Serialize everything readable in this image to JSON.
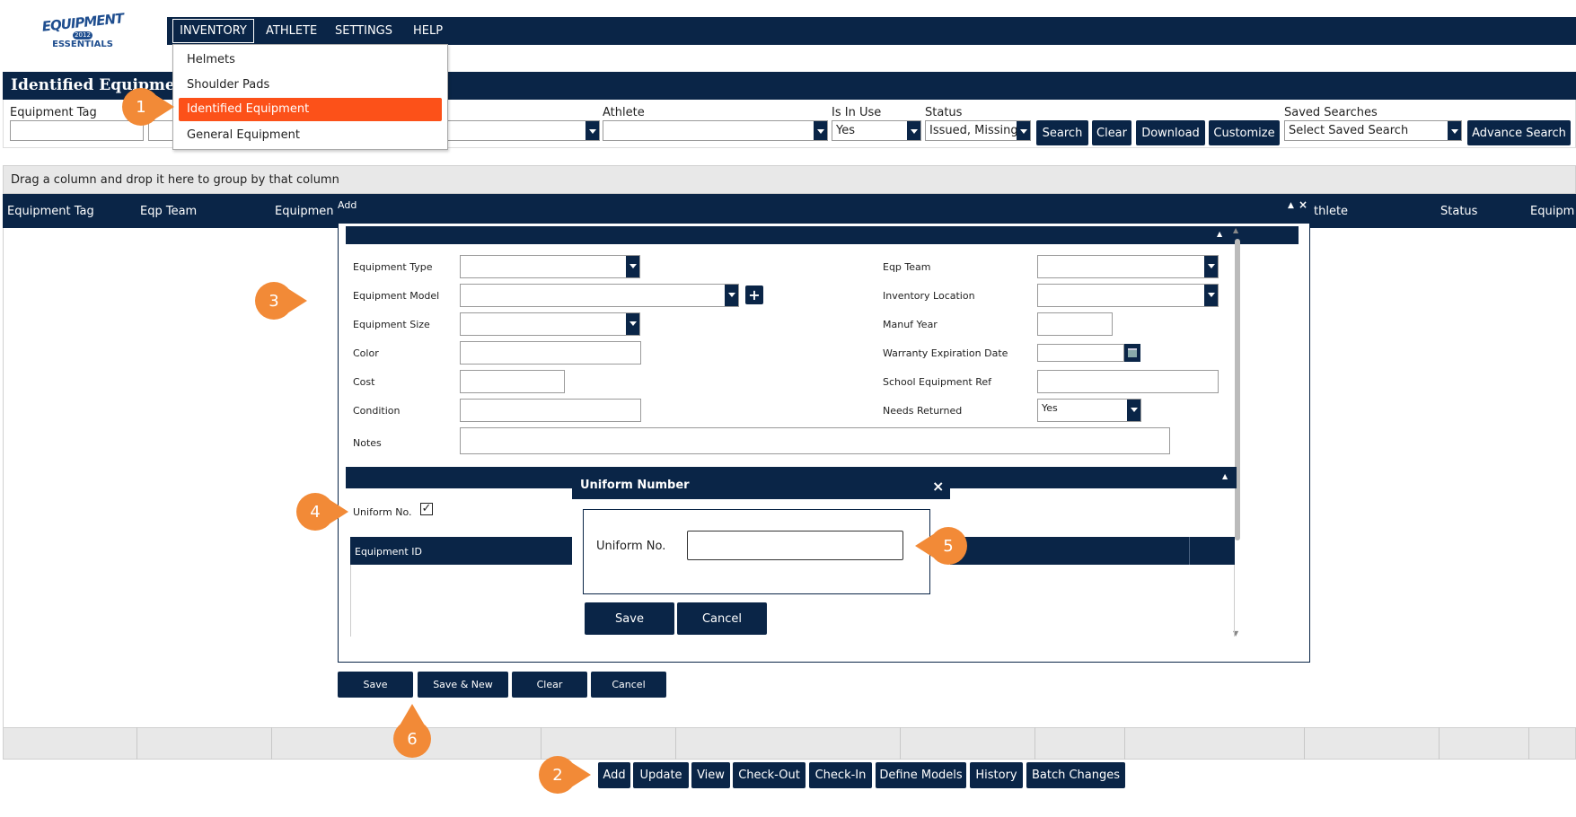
{
  "logo": {
    "line1": "EQUIPMENT",
    "year": "2012",
    "line2": "ESSENTIALS"
  },
  "nav": {
    "items": [
      "INVENTORY",
      "ATHLETE",
      "SETTINGS",
      "HELP"
    ]
  },
  "dropdown": {
    "items": [
      "Helmets",
      "Shoulder Pads",
      "Identified Equipment",
      "General Equipment"
    ]
  },
  "page": {
    "title": "Identified Equipment"
  },
  "filters": {
    "equipment_tag_label": "Equipment Tag",
    "athlete_label": "Athlete",
    "in_use_label": "Is In Use",
    "in_use_value": "Yes",
    "status_label": "Status",
    "status_value": "Issued, Missing",
    "saved_label": "Saved Searches",
    "saved_value": "Select Saved Search",
    "search": "Search",
    "clear": "Clear",
    "download": "Download",
    "customize": "Customize",
    "advance": "Advance Search"
  },
  "grid": {
    "group_hint": "Drag a column and drop it here to group by that column",
    "columns": [
      "Equipment Tag",
      "Eqp Team",
      "Equipmen",
      "thlete",
      "Status",
      "Equipm"
    ]
  },
  "modal": {
    "title": "Add",
    "fields_left": [
      "Equipment Type",
      "Equipment Model",
      "Equipment Size",
      "Color",
      "Cost",
      "Condition",
      "Notes"
    ],
    "fields_right": [
      "Eqp Team",
      "Inventory Location",
      "Manuf Year",
      "Warranty Expiration Date",
      "School Equipment Ref",
      "Needs Returned"
    ],
    "needs_returned_value": "Yes",
    "uniform_label": "Uniform No.",
    "equipment_id_col": "Equipment ID",
    "buttons": [
      "Save",
      "Save & New",
      "Clear",
      "Cancel"
    ]
  },
  "uniform_dialog": {
    "title": "Uniform Number",
    "close": "×",
    "label": "Uniform No.",
    "save": "Save",
    "cancel": "Cancel"
  },
  "bottom_buttons": [
    "Add",
    "Update",
    "View",
    "Check-Out",
    "Check-In",
    "Define Models",
    "History",
    "Batch Changes"
  ],
  "markers": [
    "1",
    "2",
    "3",
    "4",
    "5",
    "6"
  ],
  "colors": {
    "navy": "#0a2547",
    "active": "#fc5119",
    "marker": "#f28a37"
  }
}
